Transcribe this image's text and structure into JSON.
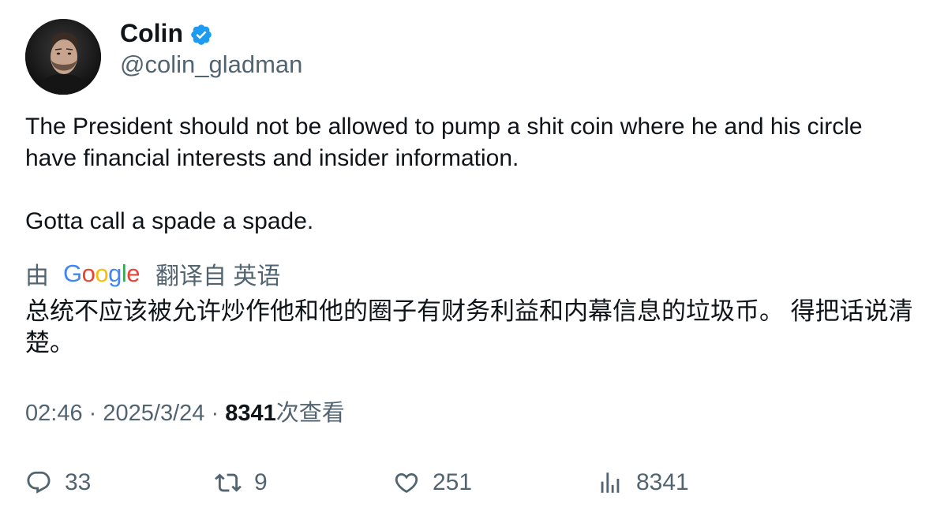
{
  "author": {
    "display_name": "Colin",
    "handle": "@colin_gladman",
    "verified": true,
    "verified_color": "#1d9bf0"
  },
  "tweet": {
    "paragraphs": [
      "The President should not be allowed to pump a shit coin where he and his circle",
      "have financial interests and insider information.",
      "Gotta call a spade a spade."
    ]
  },
  "translation": {
    "prefix": "由",
    "provider_logo": "Google",
    "suffix": "翻译自 英语",
    "text": "总统不应该被允许炒作他和他的圈子有财务利益和内幕信息的垃圾币。 得把话说清楚。"
  },
  "meta": {
    "time": "02:46",
    "separator": "·",
    "date": "2025/3/24",
    "views_count": "8341",
    "views_label": "次查看"
  },
  "actions": {
    "reply": {
      "icon": "reply-icon",
      "count": "33"
    },
    "retweet": {
      "icon": "retweet-icon",
      "count": "9"
    },
    "like": {
      "icon": "heart-icon",
      "count": "251"
    },
    "views": {
      "icon": "bar-chart-icon",
      "count": "8341"
    }
  },
  "colors": {
    "text_primary": "#0f1419",
    "text_secondary": "#536471",
    "google_blue": "#4285f4",
    "google_red": "#ea4335",
    "google_yellow": "#fbbc05",
    "google_green": "#34a853"
  }
}
